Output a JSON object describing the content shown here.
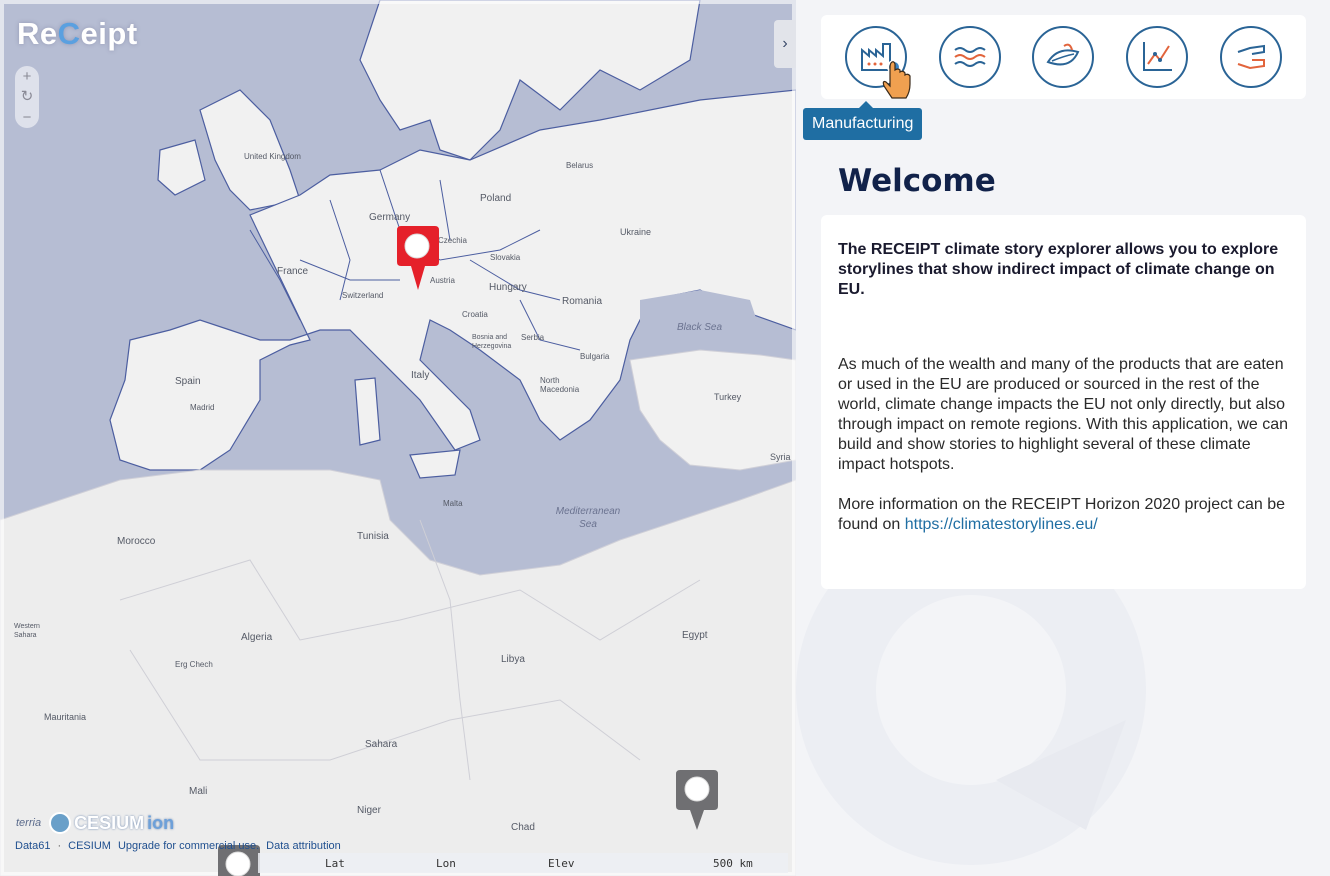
{
  "app": {
    "logo": "ReCeipt",
    "logo_prefix": "Re",
    "logo_swirl": "C",
    "logo_suffix": "eipt"
  },
  "map": {
    "zoom_in": "+",
    "refresh": "↻",
    "zoom_out": "−",
    "collapse": "›",
    "labels": {
      "united_kingdom": "United Kingdom",
      "germany": "Germany",
      "poland": "Poland",
      "belarus": "Belarus",
      "czechia": "Czechia",
      "ukraine": "Ukraine",
      "slovakia": "Slovakia",
      "austria": "Austria",
      "hungary": "Hungary",
      "switzerland": "Switzerland",
      "france": "France",
      "romania": "Romania",
      "croatia": "Croatia",
      "serbia": "Serbia",
      "bosnia": "Bosnia and Herzegovina",
      "bulgaria": "Bulgaria",
      "north_macedonia": "North Macedonia",
      "italy": "Italy",
      "spain": "Spain",
      "madrid": "Madrid",
      "turkey": "Turkey",
      "syria": "Syria",
      "black_sea": "Black Sea",
      "mediterranean": "Mediterranean Sea",
      "tunisia": "Tunisia",
      "morocco": "Morocco",
      "malta": "Malta",
      "algeria": "Algeria",
      "libya": "Libya",
      "egypt": "Egypt",
      "western_sahara": "Western Sahara",
      "mauritania": "Mauritania",
      "sahara": "Sahara",
      "mali": "Mali",
      "niger": "Niger",
      "chad": "Chad",
      "erg_chech": "Erg Chech"
    },
    "credits": {
      "terria": "terria",
      "cesium": "CESIUM",
      "ion": "ion"
    },
    "attribution": {
      "data61": "Data61",
      "cesium": "CESIUM",
      "upgrade": "Upgrade for commercial use.",
      "data_attribution": "Data attribution"
    },
    "status": {
      "lat": "Lat",
      "lon": "Lon",
      "elev": "Elev",
      "scale": "500 km"
    }
  },
  "panel": {
    "categories": [
      {
        "name": "Manufacturing",
        "icon": "factory-icon"
      },
      {
        "name": "Water",
        "icon": "waves-icon"
      },
      {
        "name": "Agriculture",
        "icon": "leaf-icon"
      },
      {
        "name": "Finance",
        "icon": "chart-icon"
      },
      {
        "name": "Cooperation",
        "icon": "hands-icon"
      }
    ],
    "tooltip": "Manufacturing",
    "welcome_title": "Welcome",
    "lead": "The RECEIPT climate story explorer allows you to explore storylines that show indirect impact of climate change on EU.",
    "paragraph1": "As much of the wealth and many of the products that are eaten or used in the EU are produced or sourced in the rest of the world, climate change impacts the EU not only directly, but also through impact on remote regions. With this application, we can build and show stories to highlight several of these climate impact hotspots.",
    "paragraph2_prefix": "More information on the RECEIPT Horizon 2020 project can be found on ",
    "link": "https://climatestorylines.eu/"
  },
  "colors": {
    "sea": "#b6bdd3",
    "land": "#f1f1f1",
    "border": "#4c5ea0",
    "accent": "#1f6ea3",
    "marker_red": "#e5202a",
    "marker_grey": "#6f6f72"
  }
}
